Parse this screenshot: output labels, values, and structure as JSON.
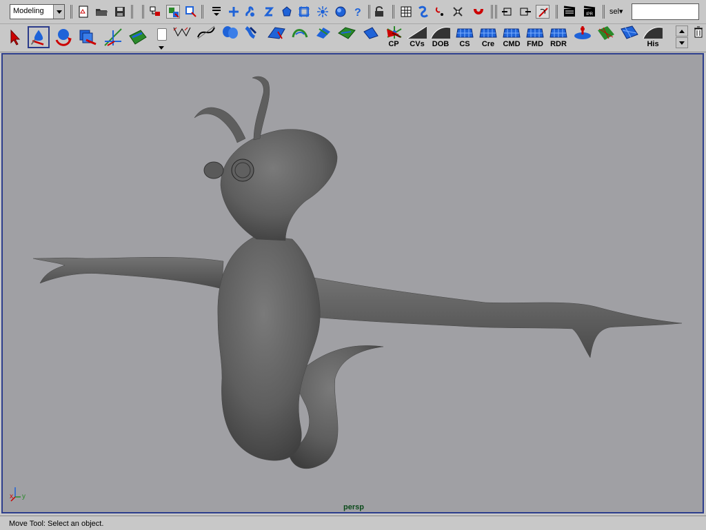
{
  "status_line": {
    "menu_set": "Modeling",
    "icons": [
      "new-scene-icon",
      "open-scene-icon",
      "save-scene-icon",
      "select-hierarchy-icon",
      "select-object-icon",
      "select-component-icon",
      "mask-menu-icon",
      "select-all-icon",
      "snap-grid-icon",
      "snap-curve-icon",
      "snap-point-icon",
      "snap-view-plane-icon",
      "make-live-icon",
      "history-icon",
      "help-icon",
      "lock-icon",
      "input-ops-icon",
      "construction-history-icon",
      "render-icon",
      "ipr-icon"
    ],
    "sel_label": "sel▾",
    "sel_field_value": ""
  },
  "shelf": {
    "tool_icons": [
      "select-tool-icon",
      "move-tool-icon",
      "rotate-tool-icon",
      "scale-tool-icon",
      "manipulator-icon",
      "show-manipulator-icon"
    ],
    "buttons": [
      {
        "icon": "cv-curve-icon",
        "label": ""
      },
      {
        "icon": "ep-curve-icon",
        "label": ""
      },
      {
        "icon": "revolve-icon",
        "label": ""
      },
      {
        "icon": "loft-icon",
        "label": ""
      },
      {
        "icon": "planar-icon",
        "label": ""
      },
      {
        "icon": "extrude-icon",
        "label": ""
      },
      {
        "icon": "bevel-icon",
        "label": ""
      },
      {
        "icon": "boundary-icon",
        "label": ""
      },
      {
        "icon": "birail-icon",
        "label": ""
      },
      {
        "icon": "normals-icon",
        "label": ""
      },
      {
        "icon": "cp-icon",
        "label": "CP"
      },
      {
        "icon": "cvs-icon",
        "label": "CVs"
      },
      {
        "icon": "dob-icon",
        "label": "DOB"
      },
      {
        "icon": "cs-icon",
        "label": "CS"
      },
      {
        "icon": "cre-icon",
        "label": "Cre"
      },
      {
        "icon": "cmd-icon",
        "label": "CMD"
      },
      {
        "icon": "fmd-icon",
        "label": "FMD"
      },
      {
        "icon": "rdr-icon",
        "label": "RDR"
      },
      {
        "icon": "sculpt-icon",
        "label": ""
      },
      {
        "icon": "paint-icon",
        "label": ""
      },
      {
        "icon": "surface-tool-icon",
        "label": ""
      },
      {
        "icon": "his-icon",
        "label": "His"
      }
    ]
  },
  "viewport": {
    "camera": "persp",
    "axis": {
      "x": "x",
      "y": "y"
    }
  },
  "help_line": "Move Tool: Select an object.",
  "colors": {
    "ui_gray": "#c8c8c8",
    "viewport_bg": "#a0a0a4",
    "viewport_border": "#2c3d8c",
    "model_gray": "#626262",
    "shelf_blue": "#1f63d8",
    "camera_label": "#0b4a1a"
  }
}
